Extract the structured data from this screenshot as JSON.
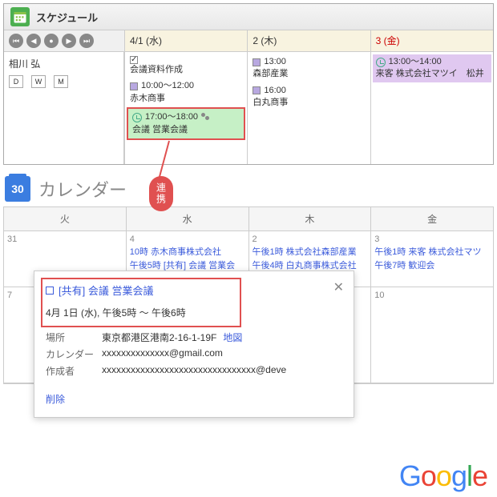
{
  "schedule": {
    "title": "スケジュール",
    "user": "相川 弘",
    "viewButtons": [
      "D",
      "W",
      "M"
    ],
    "days": [
      {
        "label": "4/1 (水)",
        "events": [
          {
            "icon": "check",
            "time": "",
            "title": "会議資料作成"
          },
          {
            "icon": "sq",
            "time": "10:00～12:00",
            "title": "赤木商事"
          },
          {
            "icon": "clock",
            "time": "17:00～18:00",
            "title": "会議 営業会議",
            "highlight": true,
            "people": true
          }
        ]
      },
      {
        "label": "2 (木)",
        "events": [
          {
            "icon": "sq",
            "time": "13:00",
            "title": "森部産業"
          },
          {
            "icon": "sq",
            "time": "16:00",
            "title": "白丸商事"
          }
        ]
      },
      {
        "label": "3 (金)",
        "friday": true,
        "events": [
          {
            "icon": "clock",
            "time": "13:00～14:00",
            "title": "来客 株式会社マツイ　松井",
            "purple": true
          }
        ]
      }
    ]
  },
  "connector": "連携",
  "calendar": {
    "iconDay": "30",
    "title": "カレンダー",
    "headers": [
      "火",
      "水",
      "木",
      "金"
    ],
    "rows": [
      [
        {
          "date": "31",
          "events": []
        },
        {
          "date": "4",
          "events": [
            "10時 赤木商事株式会社",
            "午後5時 [共有] 会議 営業会"
          ]
        },
        {
          "date": "2",
          "events": [
            "午後1時 株式会社森部産業",
            "午後4時 白丸商事株式会社"
          ]
        },
        {
          "date": "3",
          "events": [
            "午後1時 来客 株式会社マツ",
            "午後7時 歓迎会"
          ]
        }
      ],
      [
        {
          "date": "7",
          "events": []
        },
        {
          "date": "",
          "events": []
        },
        {
          "date": "",
          "events": []
        },
        {
          "date": "10",
          "events": []
        }
      ]
    ]
  },
  "popup": {
    "title": "[共有] 会議 営業会議",
    "time": "4月 1日 (水), 午後5時 ～ 午後6時",
    "locationLabel": "場所",
    "location": "東京都港区港南2-16-1-19F",
    "mapLink": "地図",
    "calendarLabel": "カレンダー",
    "calendarVal": "xxxxxxxxxxxxxx@gmail.com",
    "creatorLabel": "作成者",
    "creatorVal": "xxxxxxxxxxxxxxxxxxxxxxxxxxxxxxxx@deve",
    "delete": "削除"
  },
  "googleLogo": "Google"
}
